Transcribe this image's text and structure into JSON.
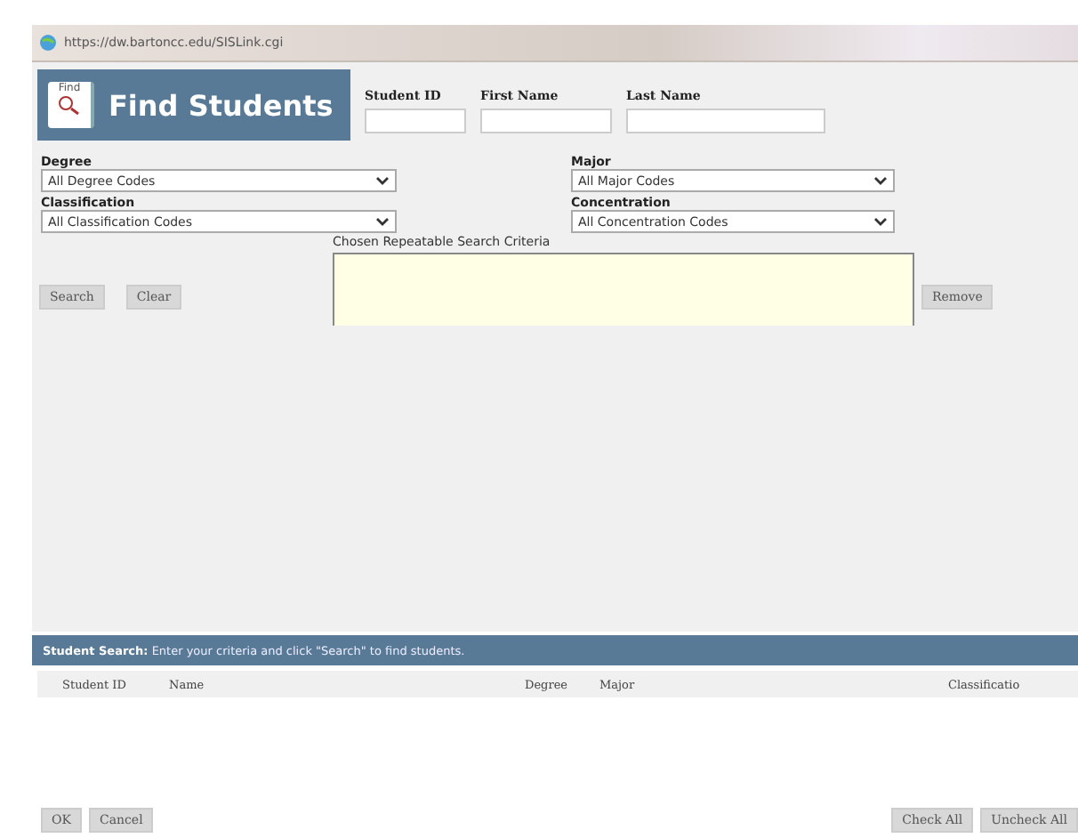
{
  "window": {
    "address": "https://dw.bartoncc.edu/SISLink.cgi"
  },
  "header": {
    "icon_label": "Find",
    "title": "Find Students"
  },
  "name_fields": [
    {
      "label": "Student ID"
    },
    {
      "label": "First Name"
    },
    {
      "label": "Last Name"
    }
  ],
  "filters": [
    {
      "label": "Degree",
      "value": "All Degree Codes"
    },
    {
      "label": "Major",
      "value": "All Major Codes"
    },
    {
      "label": "Classification",
      "value": "All Classification Codes"
    },
    {
      "label": "Concentration",
      "value": "All Concentration Codes"
    }
  ],
  "criteria": {
    "label": "Chosen Repeatable Search Criteria"
  },
  "search_buttons": [
    "Search",
    "Clear"
  ],
  "remove_button": "Remove",
  "results": {
    "banner": "**Student Search:** Enter your criteria and click \"Search\" to find students.",
    "columns": [
      "Student ID",
      "Name",
      "Degree",
      "Major",
      "Classificatio"
    ]
  },
  "footer_left": [
    "OK",
    "Cancel"
  ],
  "footer_right": [
    "Check All",
    "Uncheck All"
  ]
}
